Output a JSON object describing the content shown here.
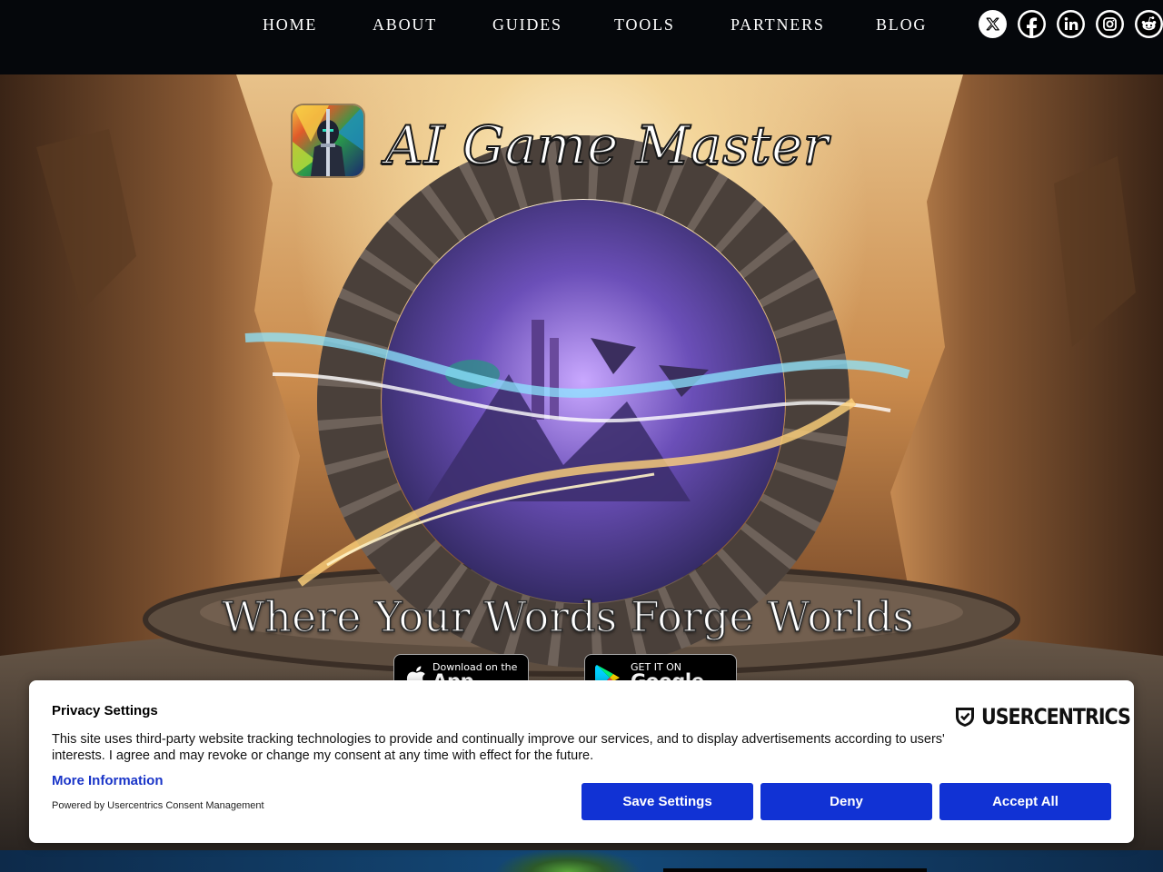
{
  "nav": {
    "links": [
      {
        "label": "HOME"
      },
      {
        "label": "ABOUT"
      },
      {
        "label": "GUIDES"
      },
      {
        "label": "TOOLS"
      },
      {
        "label": "PARTNERS"
      },
      {
        "label": "BLOG"
      }
    ],
    "socials": [
      "x-icon",
      "facebook-icon",
      "linkedin-icon",
      "instagram-icon",
      "reddit-icon"
    ]
  },
  "hero": {
    "title": "AI Game Master",
    "tagline": "Where Your Words Forge Worlds",
    "appstore": {
      "small": "Download on the",
      "big": "App Store"
    },
    "googleplay": {
      "small": "GET IT ON",
      "big": "Google Play"
    }
  },
  "consent": {
    "title": "Privacy Settings",
    "text": "This site uses third-party website tracking technologies to provide and continually improve our services, and to display advertisements according to users' interests. I agree and may revoke or change my consent at any time with effect for the future.",
    "more_info": "More Information",
    "powered_by": "Powered by Usercentrics Consent Management",
    "brand": "USERCENTRICS",
    "buttons": {
      "save": "Save Settings",
      "deny": "Deny",
      "accept": "Accept All"
    }
  },
  "colors": {
    "nav_bg": "#05070b",
    "consent_button": "#1132d4",
    "link_blue": "#1a35c8"
  }
}
